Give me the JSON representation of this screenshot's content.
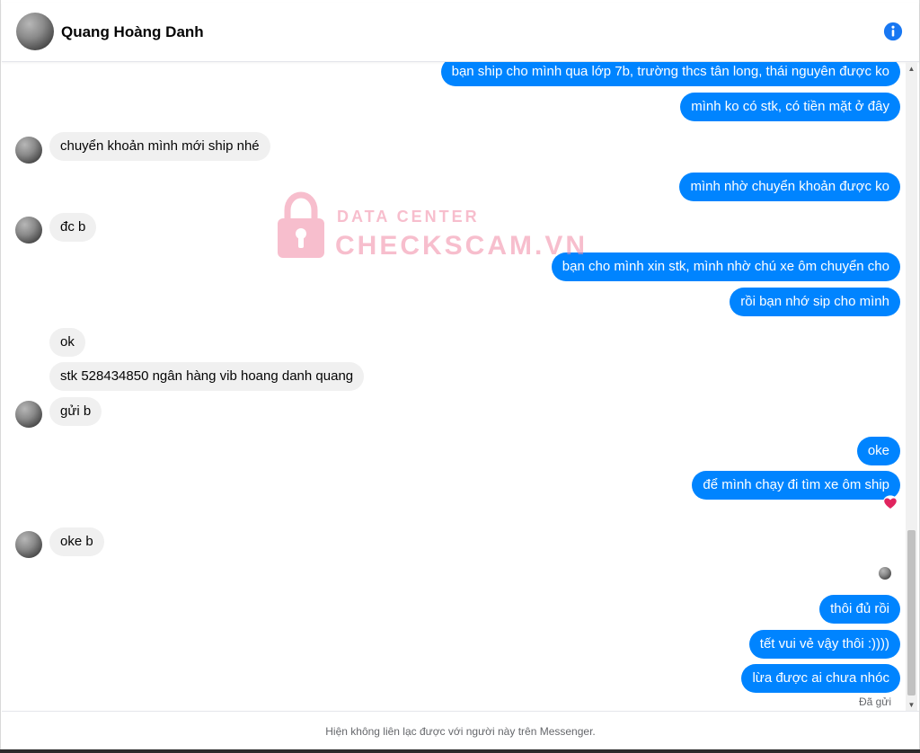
{
  "header": {
    "contact_name": "Quang Hoàng Danh",
    "info_icon": "info-icon"
  },
  "messages": [
    {
      "side": "out",
      "text": "bạn ship cho mình qua lớp 7b, trường thcs tân long, thái nguyên được ko"
    },
    {
      "side": "out",
      "text": "mình ko có stk, có tiền mặt ở đây"
    },
    {
      "side": "in",
      "text": "chuyển  khoản mình mới ship nhé"
    },
    {
      "side": "out",
      "text": "mình nhờ chuyển khoản được ko"
    },
    {
      "side": "in",
      "text": "đc b"
    },
    {
      "side": "out",
      "text": "bạn cho mình xin stk, mình nhờ chú xe ôm chuyển cho"
    },
    {
      "side": "out",
      "text": "rồi bạn nhớ sip cho mình"
    },
    {
      "side": "in",
      "text": "ok"
    },
    {
      "side": "in",
      "text": "stk 528434850 ngân hàng vib hoang danh quang"
    },
    {
      "side": "in",
      "text": "gửi b"
    },
    {
      "side": "out",
      "text": "oke"
    },
    {
      "side": "out",
      "text": "để mình chạy đi tìm xe ôm ship",
      "reaction": "heart-icon"
    },
    {
      "side": "in",
      "text": "oke b"
    },
    {
      "side": "out",
      "text": "thôi đủ rồi"
    },
    {
      "side": "out",
      "text": "tết vui vẻ vậy thôi :))))"
    },
    {
      "side": "out",
      "text": "lừa được ai chưa nhóc"
    }
  ],
  "status": "Đã gửi",
  "footer": {
    "notice": "Hiện không liên lạc được với người này trên Messenger."
  },
  "watermark": {
    "line1": "DATA CENTER",
    "line2": "CHECKSCAM.VN"
  },
  "colors": {
    "outgoing_bubble": "#0084ff",
    "incoming_bubble": "#f0f0f0",
    "info_icon": "#1877f2",
    "watermark": "#f28aa5",
    "heart": "#e0245e"
  }
}
